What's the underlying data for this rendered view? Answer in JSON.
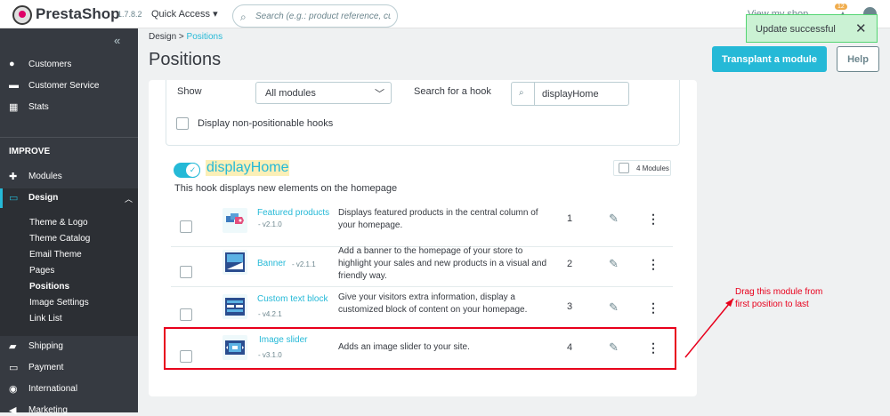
{
  "header": {
    "brand": "PrestaShop",
    "version": "1.7.8.2",
    "quick_access": "Quick Access ▾",
    "search_placeholder": "Search (e.g.: product reference, custon",
    "view_shop": "View my shop",
    "notif_count": "12"
  },
  "alert": {
    "text": "Update successful",
    "close": "✕"
  },
  "sidebar": {
    "collapse": "«",
    "items_top": [
      {
        "label": "Customers",
        "icon": "person-icon",
        "glyph": "●"
      },
      {
        "label": "Customer Service",
        "icon": "chat-icon",
        "glyph": "▬"
      },
      {
        "label": "Stats",
        "icon": "stats-icon",
        "glyph": "▦"
      }
    ],
    "section": "IMPROVE",
    "improve_items": [
      {
        "label": "Modules",
        "icon": "puzzle-icon",
        "glyph": "✚"
      },
      {
        "label": "Design",
        "icon": "monitor-icon",
        "glyph": "▭"
      }
    ],
    "design_sub": [
      "Theme & Logo",
      "Theme Catalog",
      "Email Theme",
      "Pages",
      "Positions",
      "Image Settings",
      "Link List"
    ],
    "items_bottom": [
      {
        "label": "Shipping",
        "icon": "truck-icon",
        "glyph": "▰"
      },
      {
        "label": "Payment",
        "icon": "card-icon",
        "glyph": "▭"
      },
      {
        "label": "International",
        "icon": "globe-icon",
        "glyph": "◉"
      },
      {
        "label": "Marketing",
        "icon": "megaphone-icon",
        "glyph": "◀"
      }
    ]
  },
  "breadcrumb": {
    "root": "Design",
    "sep": ">",
    "current": "Positions"
  },
  "page_title": "Positions",
  "buttons": {
    "transplant": "Transplant a module",
    "help": "Help"
  },
  "filters": {
    "show_label": "Show",
    "show_value": "All modules",
    "search_label": "Search for a hook",
    "search_value": "displayHome",
    "nonpositionable": "Display non-positionable hooks"
  },
  "hook": {
    "name": "displayHome",
    "description": "This hook displays new elements on the homepage",
    "module_count": "4 Modules"
  },
  "modules": [
    {
      "name": "Featured products",
      "version": "- v2.1.0",
      "description": "Displays featured products in the central column of your homepage.",
      "position": "1",
      "accent": "#25b9d7"
    },
    {
      "name": "Banner",
      "version": "- v2.1.1",
      "description": "Add a banner to the homepage of your store to highlight your sales and new products in a visual and friendly way.",
      "position": "2",
      "accent": "#25b9d7"
    },
    {
      "name": "Custom text block",
      "version": "- v4.2.1",
      "description": "Give your visitors extra information, display a customized block of content on your homepage.",
      "position": "3",
      "accent": "#25b9d7"
    },
    {
      "name": "Image slider",
      "version": "- v3.1.0",
      "description": "Adds an image slider to your site.",
      "position": "4",
      "accent": "#25b9d7"
    }
  ],
  "annotation": {
    "text": "Drag this module from first position to last",
    "color": "#e8001c"
  },
  "colors": {
    "primary": "#25b9d7",
    "sidebar": "#363a41",
    "success_bg": "#cbf2d4"
  }
}
